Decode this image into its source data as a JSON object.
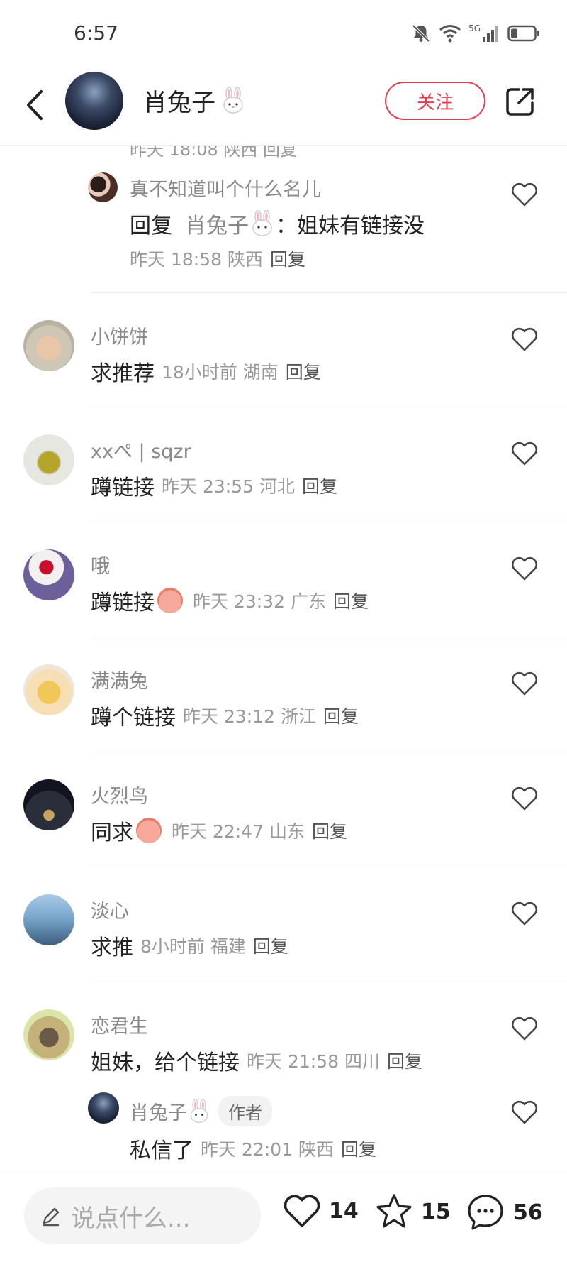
{
  "status": {
    "time": "6:57",
    "network": "5G"
  },
  "header": {
    "username": "肖兔子",
    "follow_label": "关注"
  },
  "partial_top": {
    "text": "昨天 18:08 陕西 回复"
  },
  "sub_reply_1": {
    "name": "真不知道叫个什么名儿",
    "prefix": "回复",
    "target": "肖兔子",
    "colon": "：",
    "text": "姐妹有链接没",
    "meta": "昨天 18:58 陕西",
    "reply": "回复"
  },
  "comments": [
    {
      "name": "小饼饼",
      "text": "求推荐",
      "meta": "18小时前  湖南",
      "reply": "回复"
    },
    {
      "name": "xxぺ | sqzr",
      "text": "蹲链接",
      "meta": "昨天 23:55 河北",
      "reply": "回复"
    },
    {
      "name": "哦",
      "text": "蹲链接",
      "meta": "昨天 23:32 广东",
      "reply": "回复"
    },
    {
      "name": "满满兔",
      "text": "蹲个链接",
      "meta": "昨天 23:12 浙江",
      "reply": "回复"
    },
    {
      "name": "火烈鸟",
      "text": "同求",
      "meta": "昨天 22:47 山东",
      "reply": "回复"
    },
    {
      "name": "淡心",
      "text": "求推",
      "meta": "8小时前  福建",
      "reply": "回复"
    },
    {
      "name": "恋君生",
      "text": "姐妹，给个链接",
      "meta": "昨天 21:58 四川",
      "reply": "回复"
    }
  ],
  "author_reply": {
    "name": "肖兔子",
    "tag": "作者",
    "text": "私信了",
    "meta": "昨天 22:01 陕西",
    "reply": "回复"
  },
  "bottom": {
    "placeholder": "说点什么...",
    "likes": "14",
    "stars": "15",
    "comments": "56"
  },
  "colors": {
    "accent": "#e23d4e",
    "meta": "#999999",
    "name": "#888888"
  }
}
